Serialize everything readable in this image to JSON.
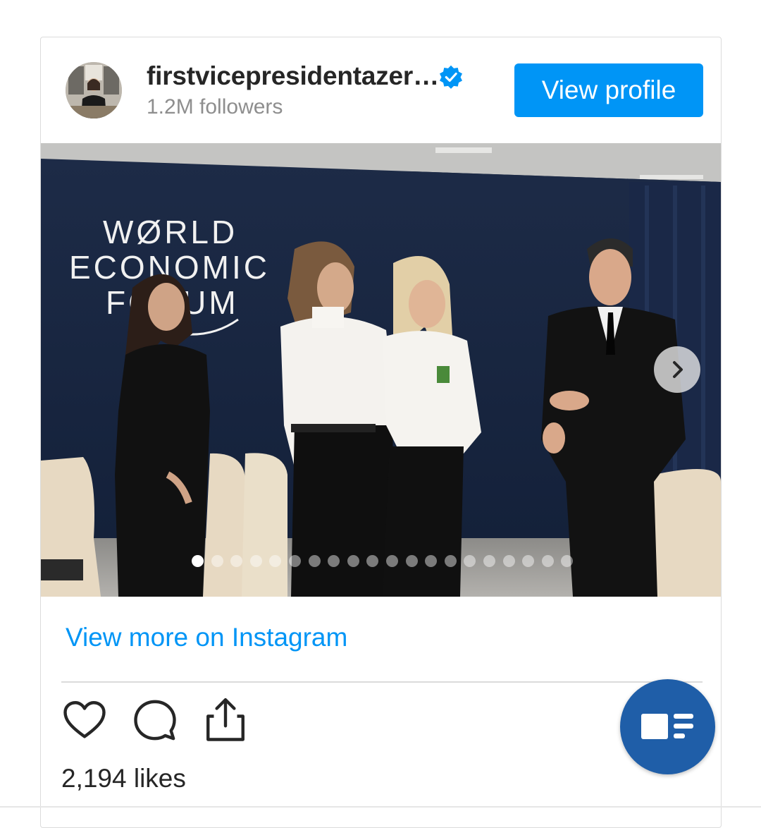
{
  "post": {
    "username": "firstvicepresidentazer…",
    "followers": "1.2M followers",
    "view_profile_label": "View profile",
    "photo_banner_text": [
      "WØRLD",
      "ECONOMIC",
      "FORUM"
    ],
    "carousel": {
      "total_slides": 20,
      "active_index": 0
    },
    "view_more_label": "View more on Instagram",
    "likes": "2,194 likes"
  },
  "icons": {
    "verified": "verified-badge-icon",
    "next": "chevron-right-icon",
    "like": "heart-icon",
    "comment": "comment-icon",
    "share": "share-icon",
    "fab": "reader-view-icon"
  },
  "colors": {
    "accent": "#0095f6",
    "fab": "#1f5ea8",
    "text": "#262626",
    "muted": "#8e8e8e"
  }
}
